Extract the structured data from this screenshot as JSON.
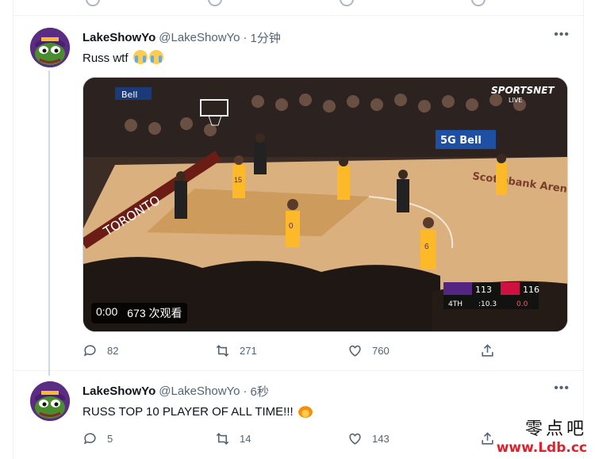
{
  "tweets": [
    {
      "name": "LakeShowYo",
      "handle": "@LakeShowYo",
      "separator": "·",
      "time": "1分钟",
      "text": "Russ wtf",
      "emoji": [
        "loudly-crying-face",
        "loudly-crying-face"
      ],
      "video": {
        "time": "0:00",
        "views": "673 次观看"
      },
      "stats": {
        "replies": "82",
        "retweets": "271",
        "likes": "760"
      }
    },
    {
      "name": "LakeShowYo",
      "handle": "@LakeShowYo",
      "separator": "·",
      "time": "6秒",
      "text": "RUSS TOP 10 PLAYER OF ALL TIME!!!",
      "emoji": [
        "fire"
      ],
      "stats": {
        "replies": "5",
        "retweets": "14",
        "likes": "143"
      }
    }
  ],
  "video_overlay": {
    "broadcaster": "SPORTSNET",
    "broadcaster_sub": "LIVE",
    "arena": "Scotiabank Arena",
    "sponsor1": "Bell",
    "sponsor2": "5G Bell",
    "score_home": "113",
    "score_away": "116",
    "quarter": "4TH",
    "clock": ":10.3",
    "shot_clock": "0.0",
    "jersey1": "15",
    "jersey2": "0",
    "jersey3": "6",
    "court_text": "TORONTO"
  },
  "watermark": {
    "cn": "零点吧",
    "url": "www.Ldb.cc"
  },
  "colors": {
    "secondary_text": "#536471",
    "border": "#eff3f4",
    "lakers_gold": "#fdb927",
    "raptors_red": "#ce1141"
  }
}
